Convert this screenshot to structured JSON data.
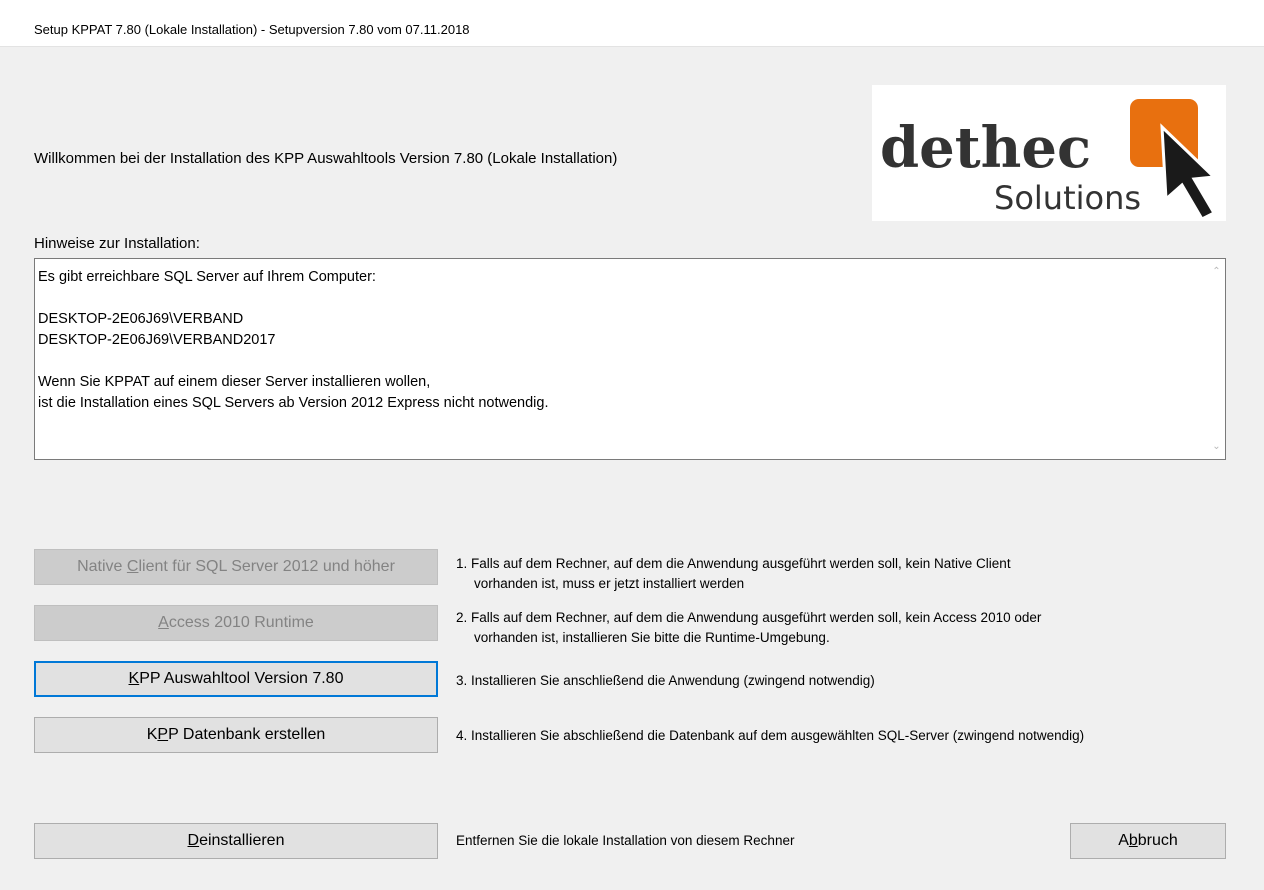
{
  "window": {
    "title": "Setup KPPAT 7.80 (Lokale Installation) - Setupversion 7.80 vom 07.11.2018"
  },
  "welcome_text": "Willkommen bei der Installation des KPP Auswahltools Version 7.80 (Lokale Installation)",
  "logo": {
    "word1": "dethec",
    "word2": "Solutions",
    "colors": {
      "text": "#333333",
      "square": "#e8700f",
      "cursor": "#1a1a1a"
    }
  },
  "hints": {
    "label": "Hinweise zur Installation:",
    "lines": [
      "Es gibt erreichbare SQL Server auf Ihrem Computer:",
      "",
      "DESKTOP-2E06J69\\VERBAND",
      "DESKTOP-2E06J69\\VERBAND2017",
      "",
      "Wenn Sie KPPAT auf einem dieser Server installieren wollen,",
      "ist die Installation eines SQL Servers ab Version 2012 Express nicht notwendig."
    ]
  },
  "buttons": {
    "native_client": {
      "pre": "Native ",
      "key": "C",
      "post": "lient für SQL Server 2012 und höher",
      "enabled": false
    },
    "access_runtime": {
      "pre": "",
      "key": "A",
      "post": "ccess 2010 Runtime",
      "enabled": false
    },
    "kpp_tool": {
      "pre": "",
      "key": "K",
      "post": "PP Auswahltool Version 7.80",
      "enabled": true
    },
    "kpp_db": {
      "pre": "K",
      "key": "P",
      "post": "P Datenbank erstellen",
      "enabled": true
    },
    "uninstall": {
      "pre": "",
      "key": "D",
      "post": "einstallieren",
      "enabled": true
    },
    "cancel": {
      "pre": "A",
      "key": "b",
      "post": "bruch",
      "enabled": true
    }
  },
  "steps": {
    "step1": {
      "line1": "1. Falls auf dem Rechner, auf dem die Anwendung ausgeführt werden soll, kein Native Client",
      "line2": "vorhanden ist, muss er jetzt installiert werden"
    },
    "step2": {
      "line1": "2. Falls auf dem Rechner, auf dem die Anwendung ausgeführt werden soll, kein Access 2010 oder",
      "line2": "vorhanden ist, installieren Sie bitte die Runtime-Umgebung."
    },
    "step3": "3. Installieren Sie anschließend die Anwendung (zwingend notwendig)",
    "step4": "4. Installieren Sie abschließend die Datenbank auf dem ausgewählten SQL-Server (zwingend notwendig)"
  },
  "remove_text": "Entfernen Sie die lokale Installation von diesem Rechner"
}
